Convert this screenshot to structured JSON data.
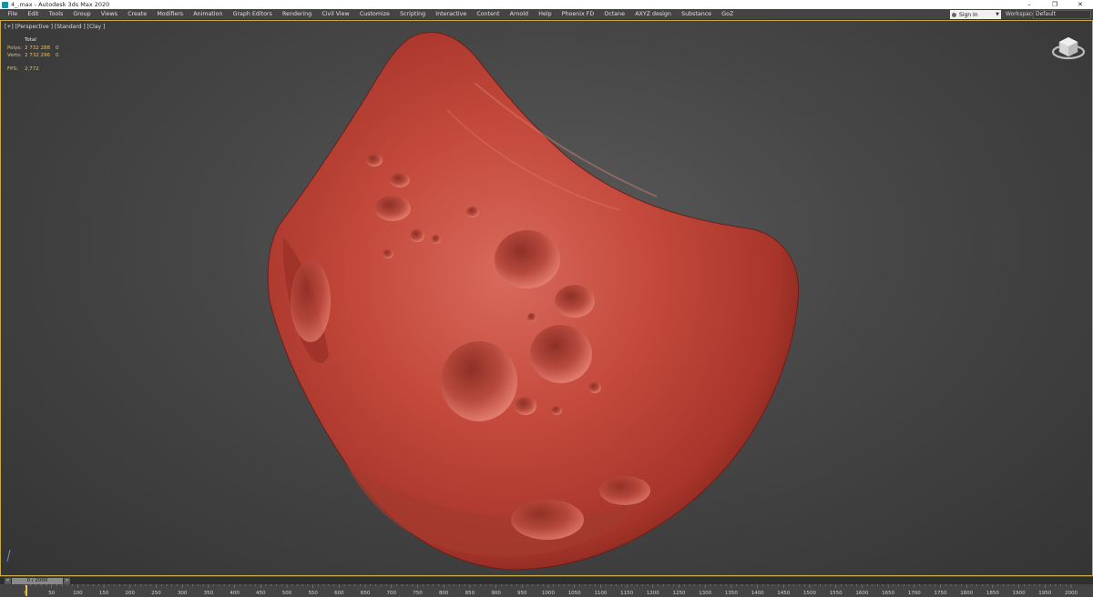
{
  "window": {
    "title": "4_.max - Autodesk 3ds Max 2020",
    "controls": [
      "–",
      "❐",
      "✕"
    ]
  },
  "menu": {
    "items": [
      "File",
      "Edit",
      "Tools",
      "Group",
      "Views",
      "Create",
      "Modifiers",
      "Animation",
      "Graph Editors",
      "Rendering",
      "Civil View",
      "Customize",
      "Scripting",
      "Interactive",
      "Content",
      "Arnold",
      "Help",
      "Phoenix FD",
      "Octane",
      "AXYZ design",
      "Substance",
      "GoZ"
    ],
    "sign_in": "Sign In",
    "workspaces_label": "Workspaces:",
    "workspace_value": "Default"
  },
  "viewport": {
    "label": "[+] [Perspective ] [Standard ] [Clay ]",
    "stats": {
      "header": "Total",
      "polys_label": "Polys:",
      "polys_value": "2 732 288",
      "polys_sel": "0",
      "verts_label": "Verts:",
      "verts_value": "2 732 296",
      "verts_sel": "0",
      "fps_label": "FPS:",
      "fps_value": "2,772"
    },
    "object_color": "#b83a30",
    "border_color": "#c8a94a"
  },
  "timeline": {
    "frame_display": "0 / 2000",
    "prev_glyph": "<",
    "next_glyph": ">",
    "ticks": [
      "0",
      "50",
      "100",
      "150",
      "200",
      "250",
      "300",
      "350",
      "400",
      "450",
      "500",
      "550",
      "600",
      "650",
      "700",
      "750",
      "800",
      "850",
      "900",
      "950",
      "1000",
      "1050",
      "1100",
      "1150",
      "1200",
      "1250",
      "1300",
      "1350",
      "1400",
      "1450",
      "1500",
      "1550",
      "1600",
      "1650",
      "1700",
      "1750",
      "1800",
      "1850",
      "1900",
      "1950",
      "2000"
    ],
    "playhead_color": "#e6c04a"
  }
}
